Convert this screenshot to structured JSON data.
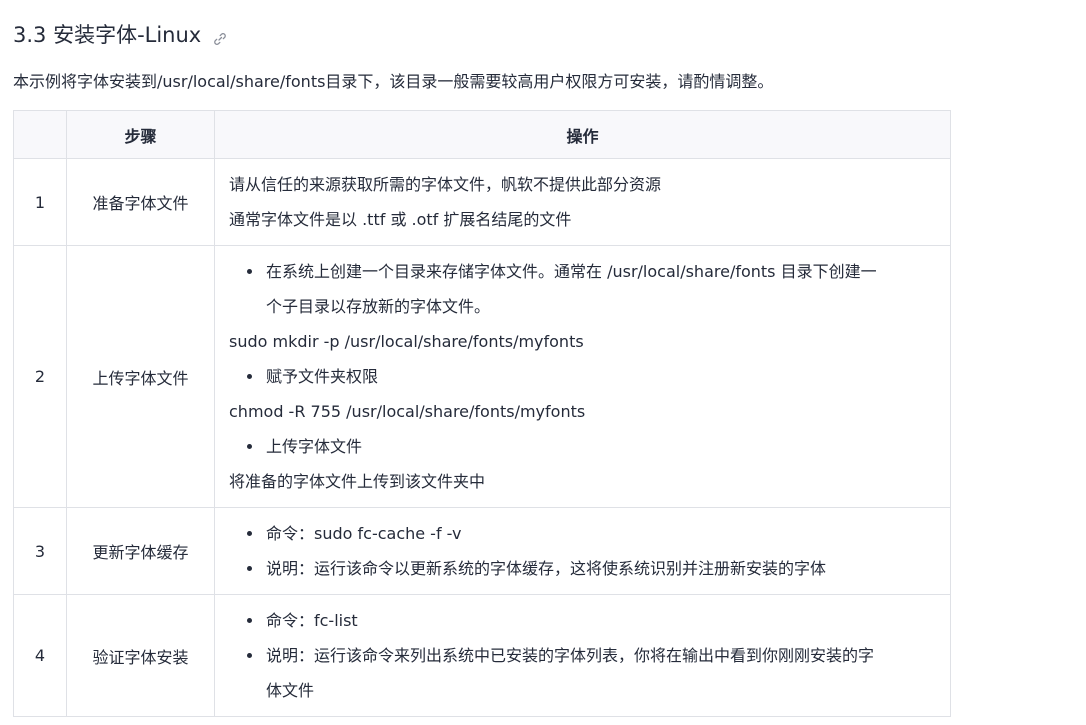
{
  "heading": {
    "title": "3.3 安装字体-Linux"
  },
  "intro": "本示例将字体安装到/usr/local/share/fonts目录下，该目录一般需要较高用户权限方可安装，请酌情调整。",
  "table": {
    "headers": [
      "",
      "步骤",
      "操作"
    ],
    "rows": [
      {
        "num": "1",
        "step": "准备字体文件",
        "lines": [
          "请从信任的来源获取所需的字体文件，帆软不提供此部分资源",
          "通常字体文件是以 .ttf 或 .otf 扩展名结尾的文件"
        ]
      },
      {
        "num": "2",
        "step": "上传字体文件",
        "bullet1_a": "在系统上创建一个目录来存储字体文件。通常在 /usr/local/share/fonts 目录下创建一",
        "bullet1_b": "个子目录以存放新的字体文件。",
        "cmd1": "sudo mkdir -p /usr/local/share/fonts/myfonts",
        "bullet2": "赋予文件夹权限",
        "cmd2": "chmod -R 755 /usr/local/share/fonts/myfonts",
        "bullet3": "上传字体文件",
        "text3": "将准备的字体文件上传到该文件夹中"
      },
      {
        "num": "3",
        "step": "更新字体缓存",
        "bullets": [
          "命令：sudo fc-cache -f -v",
          "说明：运行该命令以更新系统的字体缓存，这将使系统识别并注册新安装的字体"
        ]
      },
      {
        "num": "4",
        "step": "验证字体安装",
        "bullet1": "命令：fc-list",
        "bullet2_a": "说明：运行该命令来列出系统中已安装的字体列表，你将在输出中看到你刚刚安装的字",
        "bullet2_b": "体文件"
      }
    ]
  },
  "icons": {
    "anchor": "link-icon"
  },
  "colors": {
    "text": "#252b3a",
    "border": "#dfe1e6",
    "header_bg": "#f8f8fb"
  }
}
